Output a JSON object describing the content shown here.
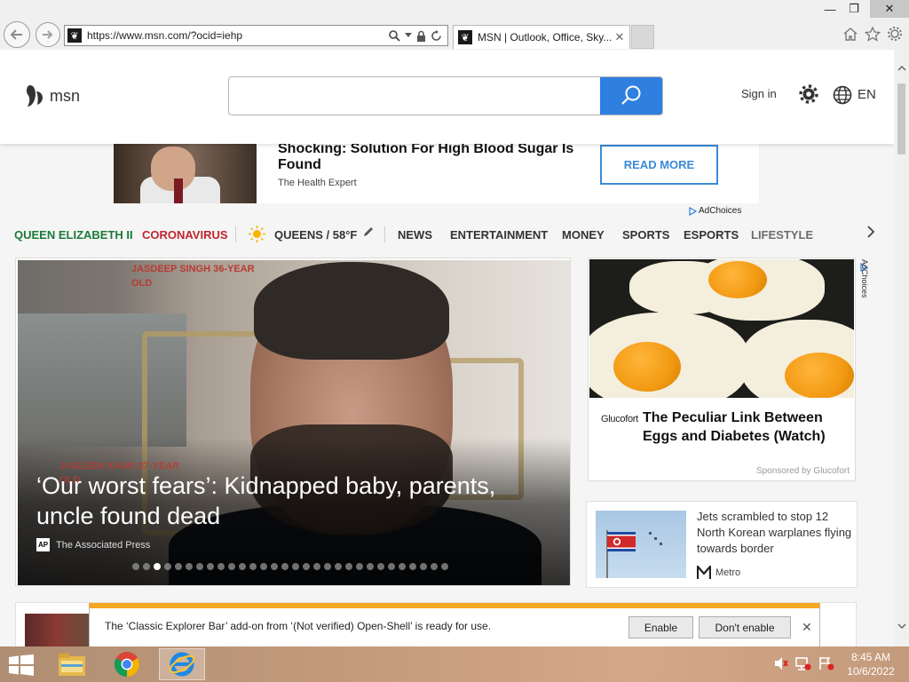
{
  "browser": {
    "url": "https://www.msn.com/?ocid=iehp",
    "tab_title": "MSN | Outlook, Office, Sky...",
    "favicon_glyph": "❦",
    "tab_close": "✕",
    "icons": [
      "back-icon",
      "forward-icon",
      "search-icon",
      "dropdown-icon",
      "lock-icon",
      "refresh-icon",
      "home-icon",
      "favorites-star-icon",
      "tools-gear-icon"
    ]
  },
  "window": {
    "minimize": "—",
    "restore": "❐",
    "close": "✕"
  },
  "msn": {
    "logo_text": "msn",
    "search_placeholder": "",
    "sign_in": "Sign in",
    "language": "EN",
    "accent": "#2f7fe0"
  },
  "ad_strip": {
    "title": "Shocking: Solution For High Blood Sugar Is Found",
    "source": "The Health Expert",
    "button": "READ MORE",
    "adchoices": "AdChoices"
  },
  "nav": {
    "items": [
      {
        "label": "QUEEN ELIZABETH II",
        "color": "#1b7a3a"
      },
      {
        "label": "CORONAVIRUS",
        "color": "#c0262d"
      },
      {
        "label": "QUEENS / 58°F",
        "color": "#333333"
      },
      {
        "label": "NEWS",
        "color": "#333333"
      },
      {
        "label": "ENTERTAINMENT",
        "color": "#333333"
      },
      {
        "label": "MONEY",
        "color": "#333333"
      },
      {
        "label": "SPORTS",
        "color": "#333333"
      },
      {
        "label": "ESPORTS",
        "color": "#333333"
      },
      {
        "label": "LIFESTYLE",
        "color": "#333333"
      }
    ]
  },
  "hero": {
    "annotation_top": "JASDEEP SINGH 36-YEAR OLD",
    "annotation_bottom": "JASLEEN KAUR 27-YEAR OLD",
    "title": "‘Our worst fears’: Kidnapped baby, parents, uncle found dead",
    "source_badge": "AP",
    "source": "The Associated Press",
    "slide_count": 30,
    "active_slide": 2
  },
  "right_ad": {
    "logo": "Glucofort",
    "title": "The Peculiar Link Between Eggs and Diabetes (Watch)",
    "sponsored": "Sponsored by Glucofort",
    "adchoices": "AdChoices"
  },
  "news_card": {
    "text": "Jets scrambled to stop 12 North Korean warplanes flying towards border",
    "source": "Metro"
  },
  "notification": {
    "message": "The ‘Classic Explorer Bar’ add-on from ‘(Not verified) Open-Shell’ is ready for use.",
    "enable": "Enable",
    "dont_enable": "Don't enable",
    "close": "✕"
  },
  "taskbar": {
    "apps": [
      "file-explorer-icon",
      "chrome-icon",
      "internet-explorer-icon"
    ],
    "time": "8:45 AM",
    "date": "10/6/2022"
  }
}
